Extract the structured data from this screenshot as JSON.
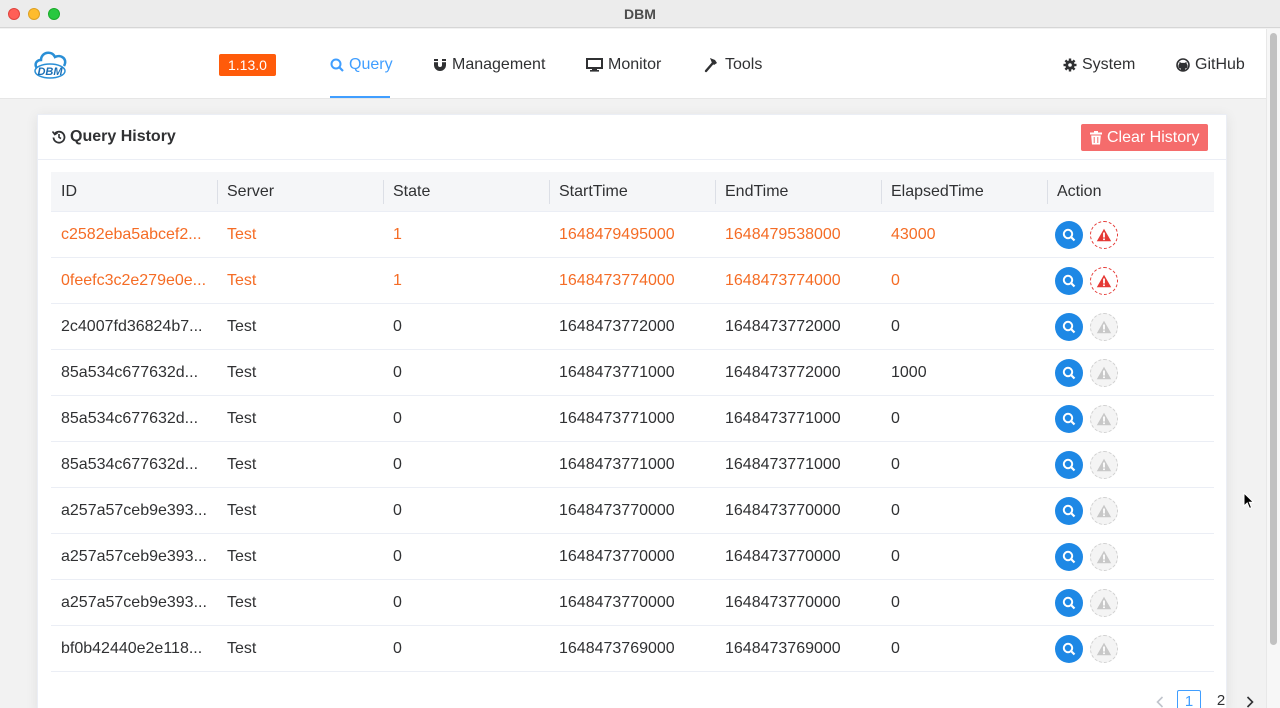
{
  "window": {
    "title": "DBM"
  },
  "header": {
    "logo_text": "DBM",
    "version": "1.13.0",
    "nav": [
      {
        "label": "Query",
        "icon": "search-icon",
        "active": true
      },
      {
        "label": "Management",
        "icon": "magnet-icon"
      },
      {
        "label": "Monitor",
        "icon": "desktop-icon"
      },
      {
        "label": "Tools",
        "icon": "hammer-icon"
      }
    ],
    "system_label": "System",
    "github_label": "GitHub"
  },
  "history": {
    "title": "Query History",
    "clear_label": "Clear History",
    "columns": [
      "ID",
      "Server",
      "State",
      "StartTime",
      "EndTime",
      "ElapsedTime",
      "Action"
    ],
    "rows": [
      {
        "id": "c2582eba5abcef2...",
        "server": "Test",
        "state": "1",
        "start": "1648479495000",
        "end": "1648479538000",
        "elapsed": "43000",
        "error": true
      },
      {
        "id": "0feefc3c2e279e0e...",
        "server": "Test",
        "state": "1",
        "start": "1648473774000",
        "end": "1648473774000",
        "elapsed": "0",
        "error": true
      },
      {
        "id": "2c4007fd36824b7...",
        "server": "Test",
        "state": "0",
        "start": "1648473772000",
        "end": "1648473772000",
        "elapsed": "0",
        "error": false
      },
      {
        "id": "85a534c677632d...",
        "server": "Test",
        "state": "0",
        "start": "1648473771000",
        "end": "1648473772000",
        "elapsed": "1000",
        "error": false
      },
      {
        "id": "85a534c677632d...",
        "server": "Test",
        "state": "0",
        "start": "1648473771000",
        "end": "1648473771000",
        "elapsed": "0",
        "error": false
      },
      {
        "id": "85a534c677632d...",
        "server": "Test",
        "state": "0",
        "start": "1648473771000",
        "end": "1648473771000",
        "elapsed": "0",
        "error": false
      },
      {
        "id": "a257a57ceb9e393...",
        "server": "Test",
        "state": "0",
        "start": "1648473770000",
        "end": "1648473770000",
        "elapsed": "0",
        "error": false
      },
      {
        "id": "a257a57ceb9e393...",
        "server": "Test",
        "state": "0",
        "start": "1648473770000",
        "end": "1648473770000",
        "elapsed": "0",
        "error": false
      },
      {
        "id": "a257a57ceb9e393...",
        "server": "Test",
        "state": "0",
        "start": "1648473770000",
        "end": "1648473770000",
        "elapsed": "0",
        "error": false
      },
      {
        "id": "bf0b42440e2e118...",
        "server": "Test",
        "state": "0",
        "start": "1648473769000",
        "end": "1648473769000",
        "elapsed": "0",
        "error": false
      }
    ]
  },
  "pagination": {
    "pages": [
      "1",
      "2"
    ],
    "current": "1"
  },
  "colors": {
    "accent": "#409eff",
    "danger": "#f56c6c",
    "error_text": "#f56c25",
    "version_badge": "#ff5b0a"
  }
}
